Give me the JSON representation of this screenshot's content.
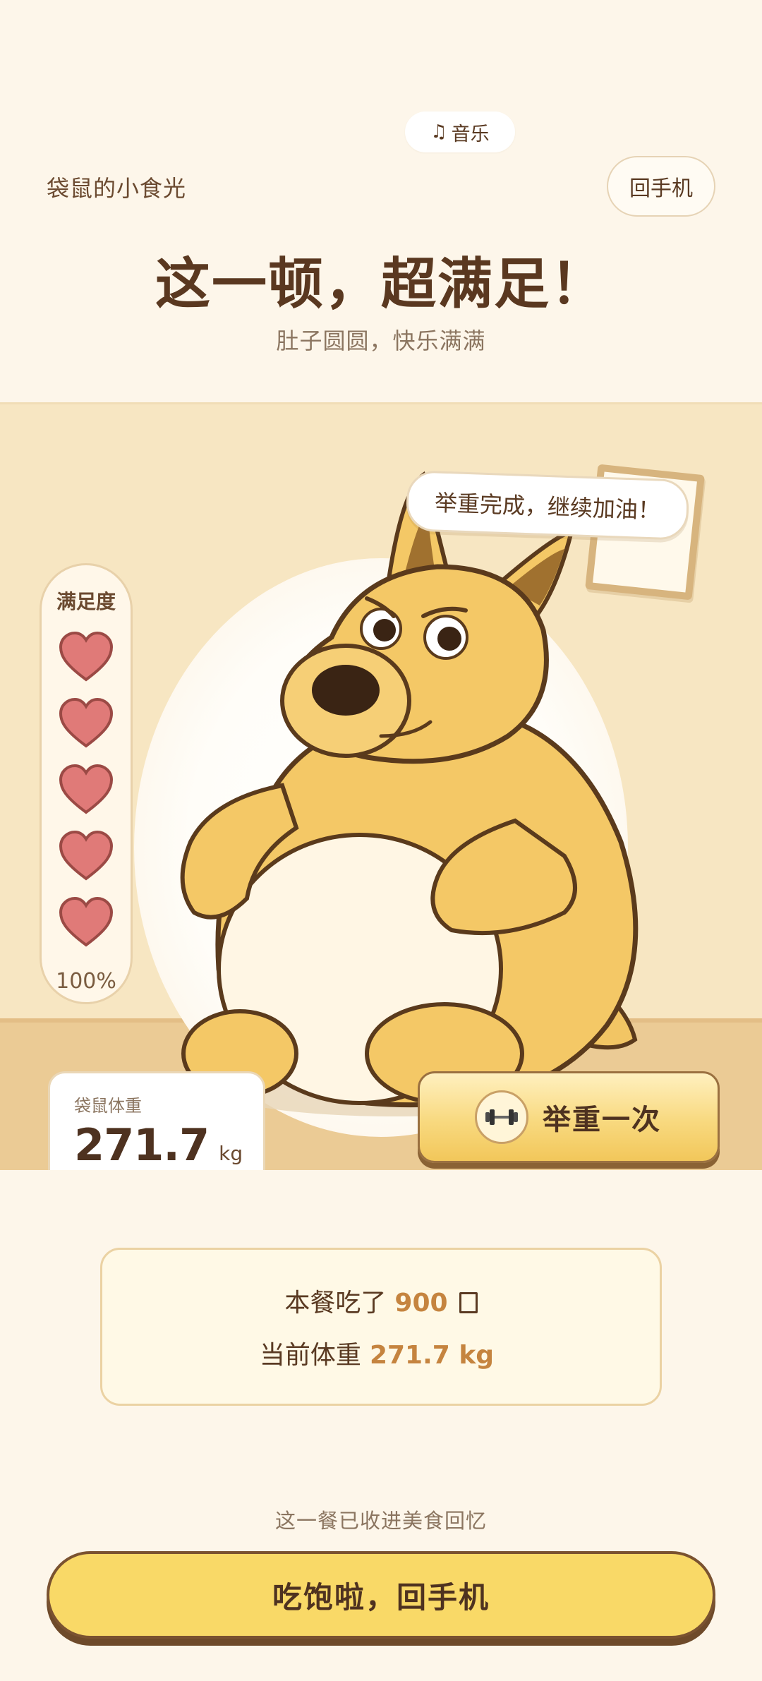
{
  "header": {
    "music_label": "音乐",
    "music_icon": "music-note-icon",
    "app_name": "袋鼠的小食光",
    "back_label": "回手机",
    "headline": "这一顿，超满足！",
    "subline": "肚子圆圆，快乐满满"
  },
  "scene": {
    "speech": "举重完成，继续加油！",
    "meter": {
      "title": "满足度",
      "hearts_filled": 5,
      "hearts_total": 5,
      "percent_label": "100%"
    },
    "weight_card": {
      "label": "袋鼠体重",
      "value": "271.7",
      "unit": "kg"
    },
    "lift_button": {
      "label": "举重一次",
      "icon": "dumbbell-icon"
    }
  },
  "summary": {
    "ate_prefix": "本餐吃了",
    "ate_value": "900",
    "weight_prefix": "当前体重",
    "weight_value": "271.7 kg"
  },
  "footer": {
    "memory_note": "这一餐已收进美食回忆",
    "main_button": "吃饱啦，回手机"
  },
  "colors": {
    "background": "#FDF6EA",
    "scene_wall": "#F7E6C2",
    "floor": "#EBCB95",
    "heart": "#E07A78",
    "accent": "#C5843F",
    "button_yellow": "#F9D967",
    "text_brown": "#5A3A22"
  }
}
